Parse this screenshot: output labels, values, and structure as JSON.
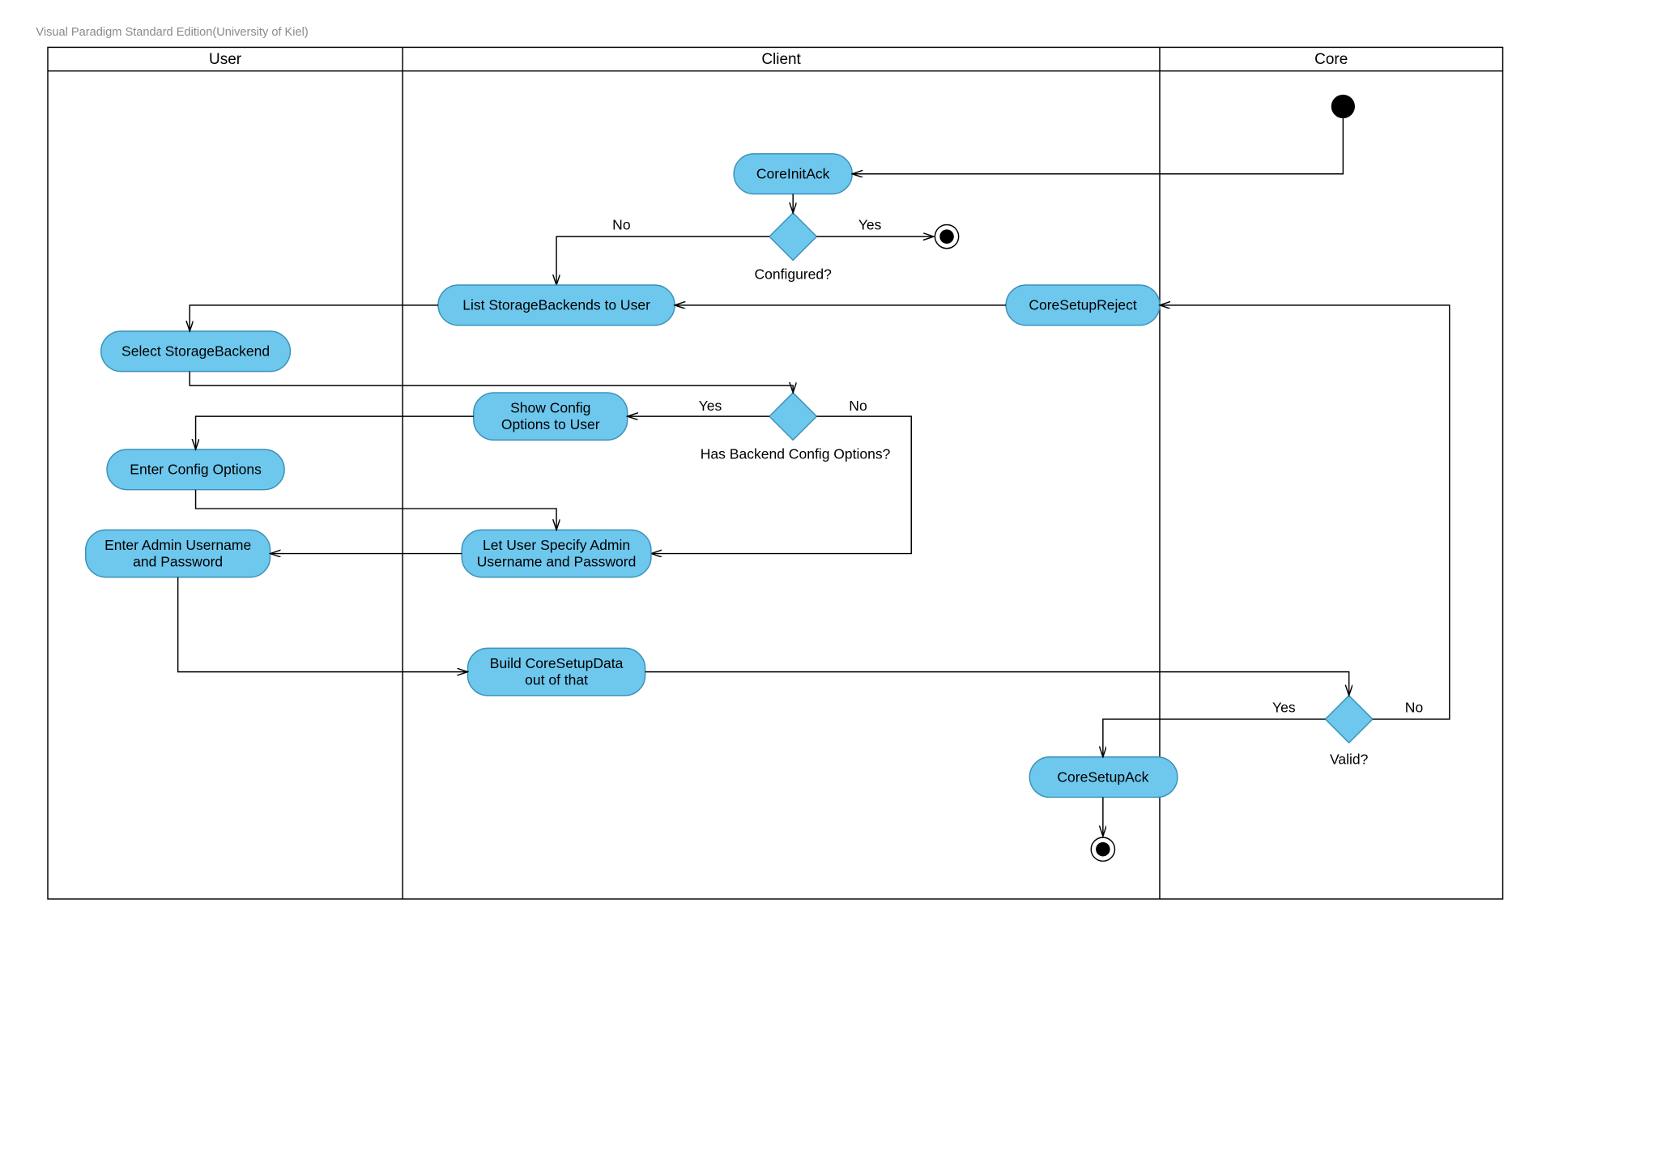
{
  "attribution": "Visual Paradigm Standard Edition(University of Kiel)",
  "swimlanes": {
    "lane1": "User",
    "lane2": "Client",
    "lane3": "Core"
  },
  "activities": {
    "coreInitAck": "CoreInitAck",
    "listStorage": "List StorageBackends to User",
    "coreSetupReject": "CoreSetupReject",
    "selectBackend": "Select StorageBackend",
    "showConfigLine1": "Show Config",
    "showConfigLine2": "Options to User",
    "enterConfig": "Enter Config Options",
    "letUserSpecLine1": "Let User Specify Admin",
    "letUserSpecLine2": "Username and Password",
    "enterAdminLine1": "Enter Admin Username",
    "enterAdminLine2": "and Password",
    "buildSetupLine1": "Build CoreSetupData",
    "buildSetupLine2": "out of that",
    "coreSetupAck": "CoreSetupAck"
  },
  "decisions": {
    "configured": "Configured?",
    "hasBackend": "Has Backend Config Options?",
    "valid": "Valid?"
  },
  "edgeLabels": {
    "yes": "Yes",
    "no": "No"
  }
}
